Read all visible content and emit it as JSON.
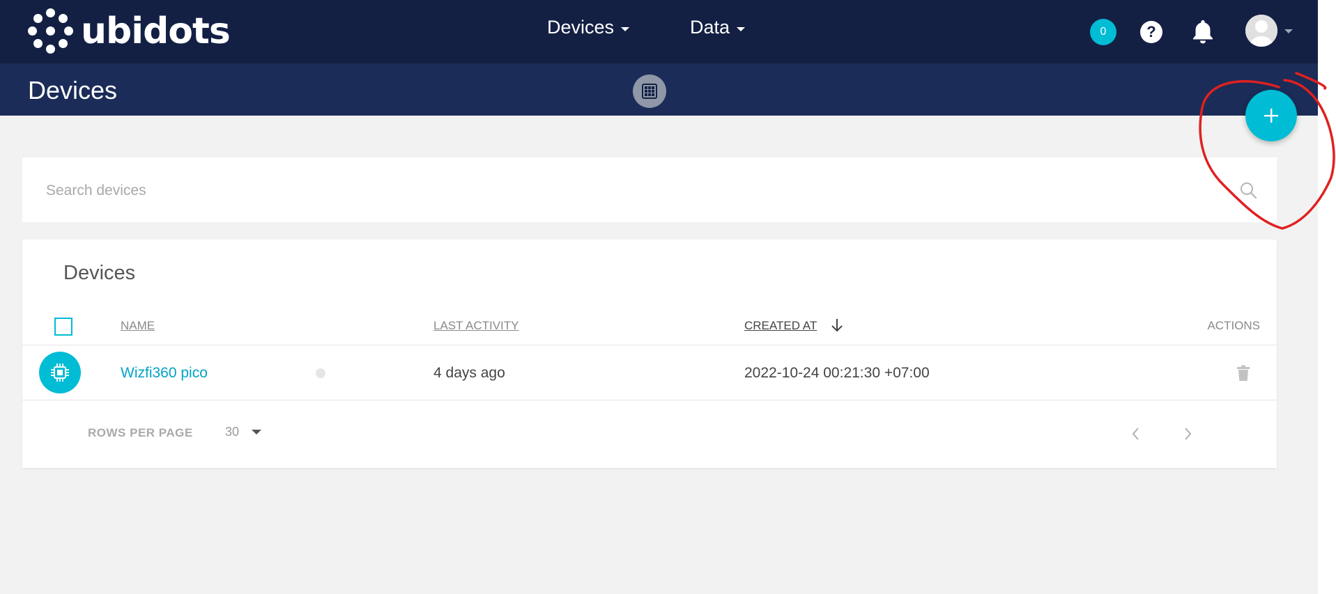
{
  "brand": {
    "name": "ubidots"
  },
  "nav": {
    "items": [
      {
        "label": "Devices"
      },
      {
        "label": "Data"
      }
    ],
    "notification_badge": "0",
    "help_label": "?"
  },
  "subheader": {
    "title": "Devices"
  },
  "search": {
    "placeholder": "Search devices",
    "value": ""
  },
  "devices_card": {
    "title": "Devices",
    "columns": {
      "name": "NAME",
      "last_activity": "LAST ACTIVITY",
      "created_at": "CREATED AT",
      "actions": "ACTIONS"
    },
    "sort": {
      "column": "created_at",
      "direction": "descending",
      "icon": "arrow-down-icon"
    },
    "rows": [
      {
        "name": "Wizfi360 pico",
        "last_activity": "4 days ago",
        "created_at": "2022-10-24 00:21:30 +07:00",
        "icon": "chip-icon",
        "status": "inactive"
      }
    ],
    "footer": {
      "rows_per_page_label": "ROWS PER PAGE",
      "rows_per_page_value": "30"
    }
  },
  "colors": {
    "navbar": "#132044",
    "subheader": "#1a2c57",
    "accent": "#00bcd4",
    "annotation": "#e02020"
  },
  "icons": {
    "fab": "plus-icon",
    "grid_toggle": "grid-icon",
    "search": "search-icon",
    "notifications": "bell-icon",
    "delete": "trash-icon"
  }
}
